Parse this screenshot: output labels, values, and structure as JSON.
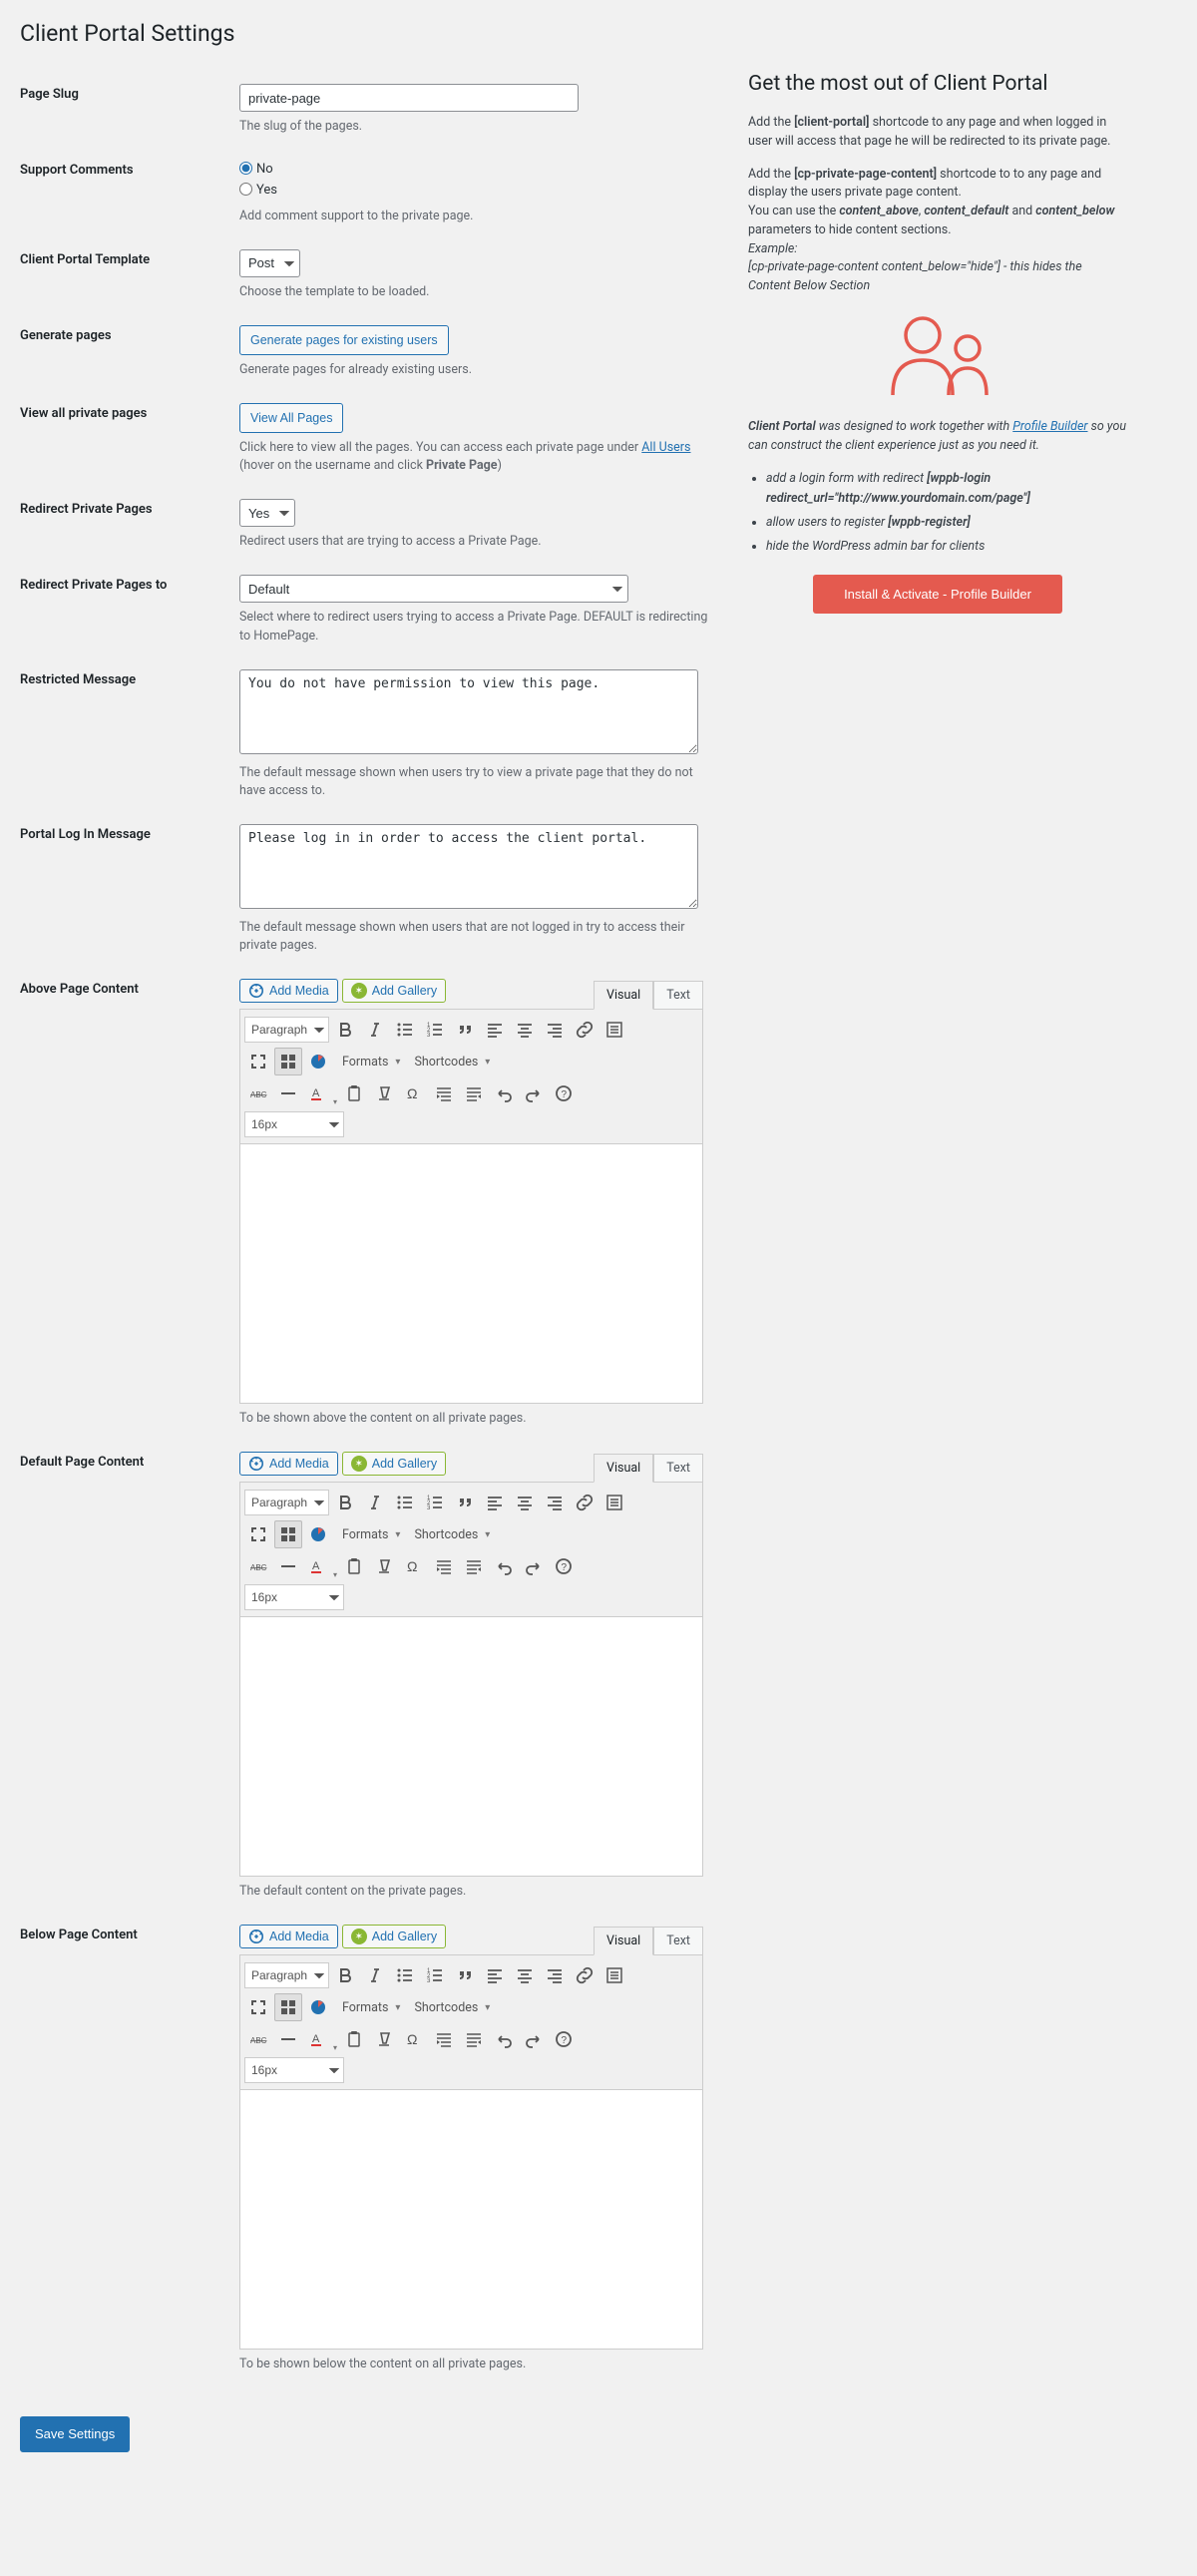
{
  "page_title": "Client Portal Settings",
  "fields": {
    "page_slug": {
      "label": "Page Slug",
      "value": "private-page",
      "desc": "The slug of the pages."
    },
    "support_comments": {
      "label": "Support Comments",
      "options": {
        "no": "No",
        "yes": "Yes"
      },
      "value": "no",
      "desc": "Add comment support to the private page."
    },
    "template": {
      "label": "Client Portal Template",
      "value": "Post",
      "desc": "Choose the template to be loaded."
    },
    "generate": {
      "label": "Generate pages",
      "button": "Generate pages for existing users",
      "desc": "Generate pages for already existing users."
    },
    "view_all": {
      "label": "View all private pages",
      "button": "View All Pages",
      "desc_pre": "Click here to view all the pages. You can access each private page under ",
      "link": "All Users",
      "desc_post_a": " (hover on the username and click ",
      "desc_bold": "Private Page",
      "desc_post_b": ")"
    },
    "redirect": {
      "label": "Redirect Private Pages",
      "value": "Yes",
      "desc": "Redirect users that are trying to access a Private Page."
    },
    "redirect_to": {
      "label": "Redirect Private Pages to",
      "value": "Default",
      "desc": "Select where to redirect users trying to access a Private Page. DEFAULT is redirecting to HomePage."
    },
    "restricted_msg": {
      "label": "Restricted Message",
      "value": "You do not have permission to view this page.",
      "desc": "The default message shown when users try to view a private page that they do not have access to."
    },
    "login_msg": {
      "label": "Portal Log In Message",
      "value": "Please log in in order to access the client portal.",
      "desc": "The default message shown when users that are not logged in try to access their private pages."
    },
    "above_content": {
      "label": "Above Page Content",
      "desc": "To be shown above the content on all private pages."
    },
    "default_content": {
      "label": "Default Page Content",
      "desc": "The default content on the private pages."
    },
    "below_content": {
      "label": "Below Page Content",
      "desc": "To be shown below the content on all private pages."
    }
  },
  "editor": {
    "add_media": "Add Media",
    "add_gallery": "Add Gallery",
    "tab_visual": "Visual",
    "tab_text": "Text",
    "paragraph": "Paragraph",
    "formats": "Formats",
    "shortcodes": "Shortcodes",
    "font_size": "16px"
  },
  "sidebar": {
    "title": "Get the most out of Client Portal",
    "p1_a": "Add the ",
    "p1_code1": "[client-portal]",
    "p1_b": " shortcode to any page and when logged in user will access that page he will be redirected to its private page.",
    "p2_a": "Add the ",
    "p2_code1": "[cp-private-page-content]",
    "p2_b": " shortcode to to any page and display the users private page content.",
    "p2_c": "You can use the ",
    "p2_em1": "content_above",
    "p2_em2": "content_default",
    "p2_and": " and ",
    "p2_em3": "content_below",
    "p2_d": " parameters to hide content sections.",
    "p2_ex_label": "Example:",
    "p2_ex": "[cp-private-page-content content_below=\"hide\"] - this hides the Content Below Section",
    "p3_a": "Client Portal",
    "p3_b": " was designed to work together with ",
    "p3_link": "Profile Builder",
    "p3_c": " so you can construct the client experience just as you need it.",
    "bullets": [
      {
        "text": "add a login form with redirect ",
        "code": "[wppb-login redirect_url=\"http://www.yourdomain.com/page\"]"
      },
      {
        "text": "allow users to register ",
        "code": "[wppb-register]"
      },
      {
        "text": "hide the WordPress admin bar for clients",
        "code": ""
      }
    ],
    "cta": "Install & Activate - Profile Builder"
  },
  "save_button": "Save Settings"
}
